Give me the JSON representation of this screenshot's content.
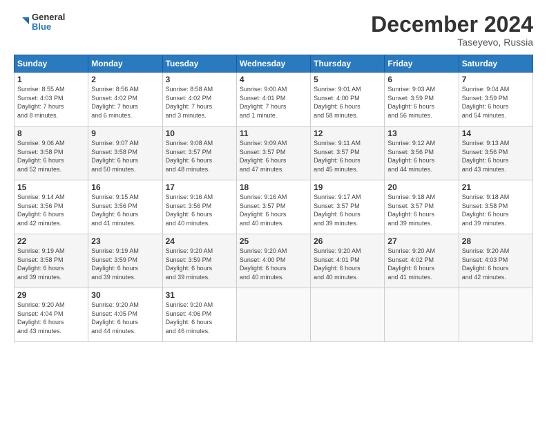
{
  "header": {
    "logo_line1": "General",
    "logo_line2": "Blue",
    "month_title": "December 2024",
    "location": "Taseyevo, Russia"
  },
  "weekdays": [
    "Sunday",
    "Monday",
    "Tuesday",
    "Wednesday",
    "Thursday",
    "Friday",
    "Saturday"
  ],
  "weeks": [
    [
      {
        "day": "1",
        "info": "Sunrise: 8:55 AM\nSunset: 4:03 PM\nDaylight: 7 hours\nand 8 minutes."
      },
      {
        "day": "2",
        "info": "Sunrise: 8:56 AM\nSunset: 4:02 PM\nDaylight: 7 hours\nand 6 minutes."
      },
      {
        "day": "3",
        "info": "Sunrise: 8:58 AM\nSunset: 4:02 PM\nDaylight: 7 hours\nand 3 minutes."
      },
      {
        "day": "4",
        "info": "Sunrise: 9:00 AM\nSunset: 4:01 PM\nDaylight: 7 hours\nand 1 minute."
      },
      {
        "day": "5",
        "info": "Sunrise: 9:01 AM\nSunset: 4:00 PM\nDaylight: 6 hours\nand 58 minutes."
      },
      {
        "day": "6",
        "info": "Sunrise: 9:03 AM\nSunset: 3:59 PM\nDaylight: 6 hours\nand 56 minutes."
      },
      {
        "day": "7",
        "info": "Sunrise: 9:04 AM\nSunset: 3:59 PM\nDaylight: 6 hours\nand 54 minutes."
      }
    ],
    [
      {
        "day": "8",
        "info": "Sunrise: 9:06 AM\nSunset: 3:58 PM\nDaylight: 6 hours\nand 52 minutes."
      },
      {
        "day": "9",
        "info": "Sunrise: 9:07 AM\nSunset: 3:58 PM\nDaylight: 6 hours\nand 50 minutes."
      },
      {
        "day": "10",
        "info": "Sunrise: 9:08 AM\nSunset: 3:57 PM\nDaylight: 6 hours\nand 48 minutes."
      },
      {
        "day": "11",
        "info": "Sunrise: 9:09 AM\nSunset: 3:57 PM\nDaylight: 6 hours\nand 47 minutes."
      },
      {
        "day": "12",
        "info": "Sunrise: 9:11 AM\nSunset: 3:57 PM\nDaylight: 6 hours\nand 45 minutes."
      },
      {
        "day": "13",
        "info": "Sunrise: 9:12 AM\nSunset: 3:56 PM\nDaylight: 6 hours\nand 44 minutes."
      },
      {
        "day": "14",
        "info": "Sunrise: 9:13 AM\nSunset: 3:56 PM\nDaylight: 6 hours\nand 43 minutes."
      }
    ],
    [
      {
        "day": "15",
        "info": "Sunrise: 9:14 AM\nSunset: 3:56 PM\nDaylight: 6 hours\nand 42 minutes."
      },
      {
        "day": "16",
        "info": "Sunrise: 9:15 AM\nSunset: 3:56 PM\nDaylight: 6 hours\nand 41 minutes."
      },
      {
        "day": "17",
        "info": "Sunrise: 9:16 AM\nSunset: 3:56 PM\nDaylight: 6 hours\nand 40 minutes."
      },
      {
        "day": "18",
        "info": "Sunrise: 9:16 AM\nSunset: 3:57 PM\nDaylight: 6 hours\nand 40 minutes."
      },
      {
        "day": "19",
        "info": "Sunrise: 9:17 AM\nSunset: 3:57 PM\nDaylight: 6 hours\nand 39 minutes."
      },
      {
        "day": "20",
        "info": "Sunrise: 9:18 AM\nSunset: 3:57 PM\nDaylight: 6 hours\nand 39 minutes."
      },
      {
        "day": "21",
        "info": "Sunrise: 9:18 AM\nSunset: 3:58 PM\nDaylight: 6 hours\nand 39 minutes."
      }
    ],
    [
      {
        "day": "22",
        "info": "Sunrise: 9:19 AM\nSunset: 3:58 PM\nDaylight: 6 hours\nand 39 minutes."
      },
      {
        "day": "23",
        "info": "Sunrise: 9:19 AM\nSunset: 3:59 PM\nDaylight: 6 hours\nand 39 minutes."
      },
      {
        "day": "24",
        "info": "Sunrise: 9:20 AM\nSunset: 3:59 PM\nDaylight: 6 hours\nand 39 minutes."
      },
      {
        "day": "25",
        "info": "Sunrise: 9:20 AM\nSunset: 4:00 PM\nDaylight: 6 hours\nand 40 minutes."
      },
      {
        "day": "26",
        "info": "Sunrise: 9:20 AM\nSunset: 4:01 PM\nDaylight: 6 hours\nand 40 minutes."
      },
      {
        "day": "27",
        "info": "Sunrise: 9:20 AM\nSunset: 4:02 PM\nDaylight: 6 hours\nand 41 minutes."
      },
      {
        "day": "28",
        "info": "Sunrise: 9:20 AM\nSunset: 4:03 PM\nDaylight: 6 hours\nand 42 minutes."
      }
    ],
    [
      {
        "day": "29",
        "info": "Sunrise: 9:20 AM\nSunset: 4:04 PM\nDaylight: 6 hours\nand 43 minutes."
      },
      {
        "day": "30",
        "info": "Sunrise: 9:20 AM\nSunset: 4:05 PM\nDaylight: 6 hours\nand 44 minutes."
      },
      {
        "day": "31",
        "info": "Sunrise: 9:20 AM\nSunset: 4:06 PM\nDaylight: 6 hours\nand 46 minutes."
      },
      {
        "day": "",
        "info": ""
      },
      {
        "day": "",
        "info": ""
      },
      {
        "day": "",
        "info": ""
      },
      {
        "day": "",
        "info": ""
      }
    ]
  ]
}
